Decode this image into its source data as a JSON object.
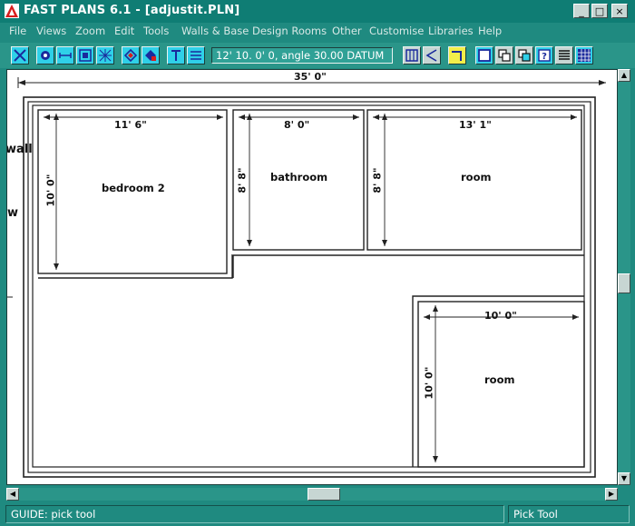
{
  "window": {
    "title": "FAST PLANS 6.1 - [adjustit.PLN]",
    "minimize_glyph": "_",
    "maximize_glyph": "□",
    "close_glyph": "×"
  },
  "menu": {
    "items": [
      {
        "label": "File"
      },
      {
        "label": "Views"
      },
      {
        "label": "Zoom"
      },
      {
        "label": "Edit"
      },
      {
        "label": "Tools"
      },
      {
        "label": "Walls & Base"
      },
      {
        "label": "Design Rooms"
      },
      {
        "label": "Other"
      },
      {
        "label": "Customise"
      },
      {
        "label": "Libraries"
      },
      {
        "label": "Help"
      }
    ]
  },
  "toolbar": {
    "readout": "12' 10. 0' 0, angle 30.00 DATUM",
    "icons": [
      "select-icon",
      "pan-icon",
      "measure-icon",
      "window-zoom-icon",
      "grid-icon",
      "diamond-icon",
      "fill-icon",
      "text-icon",
      "lines-icon",
      "columns-icon",
      "angle-icon",
      "corner-icon",
      "rectangle-icon",
      "copy-icon",
      "paste-icon",
      "help-icon",
      "list-icon",
      "pattern-icon"
    ]
  },
  "plan": {
    "overall_width_label": "35' 0\"",
    "rooms": [
      {
        "name": "bedroom 2",
        "width_label": "11' 6\"",
        "height_label": "10' 0\""
      },
      {
        "name": "bathroom",
        "width_label": "8' 0\"",
        "height_label": "8' 8\""
      },
      {
        "name": "room",
        "width_label": "13' 1\"",
        "height_label": "8' 8\""
      },
      {
        "name": "room",
        "width_label": "10' 0\"",
        "height_label": "10' 0\""
      }
    ],
    "side_text": [
      "wall",
      "w"
    ]
  },
  "status": {
    "left": "GUIDE: pick tool",
    "right": "Pick Tool"
  },
  "colors": {
    "window_teal": "#1f8a80",
    "toolbar_teal": "#2a9589",
    "button_cyan": "#2fd0e8",
    "button_yellow": "#f2ee4a",
    "button_gray": "#c7d6d3",
    "canvas": "#ffffff"
  }
}
